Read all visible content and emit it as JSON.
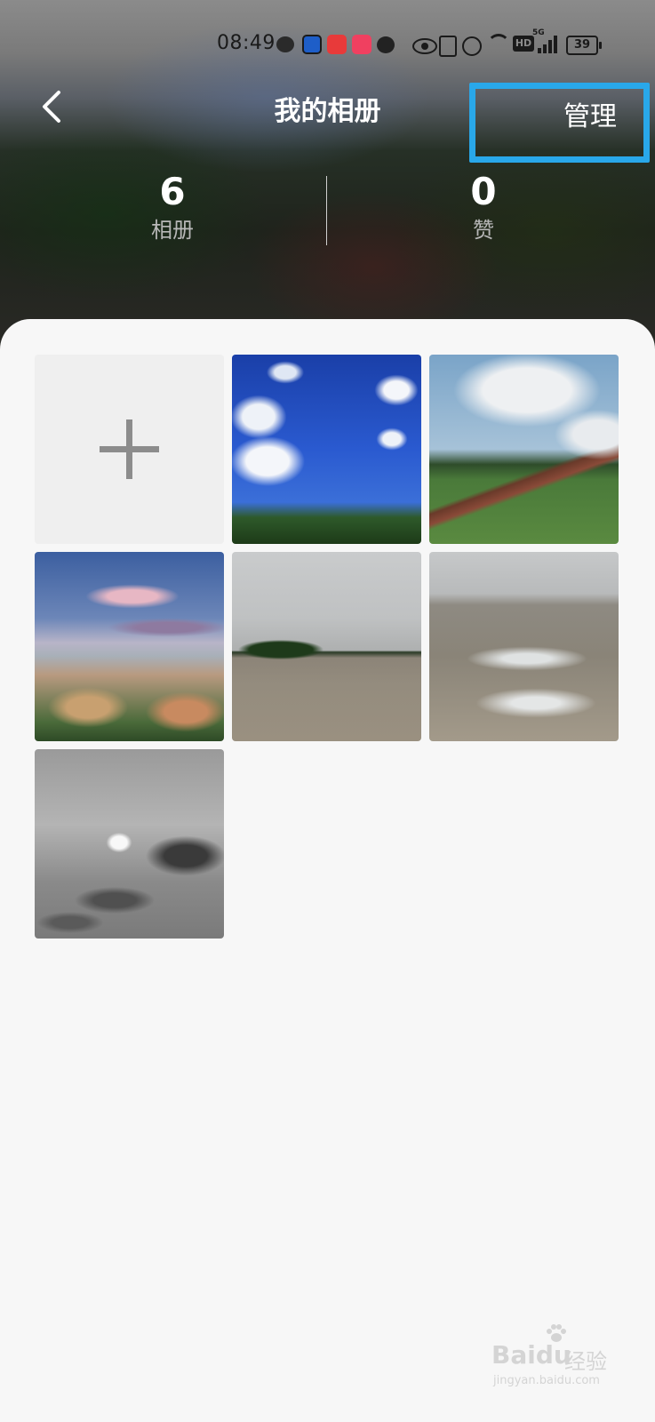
{
  "status_bar": {
    "time": "08:49",
    "battery": "39",
    "hd_label": "HD",
    "network_label": "5G",
    "notification_icons": [
      "wechat-icon",
      "qq-icon",
      "xiaohongshu-icon",
      "swan-app-icon",
      "message-icon"
    ],
    "system_icons": [
      "eye-icon",
      "nfc-icon",
      "alarm-icon",
      "wifi-icon",
      "hd-icon",
      "signal-icon",
      "battery-icon"
    ]
  },
  "header": {
    "title": "我的相册",
    "back_icon": "chevron-left-icon",
    "manage_label": "管理",
    "highlight_color": "#29a8ea"
  },
  "stats": {
    "albums": {
      "value": "6",
      "label": "相册"
    },
    "likes": {
      "value": "0",
      "label": "赞"
    }
  },
  "albums": {
    "add_tile_icon": "plus-icon",
    "photos": [
      {
        "name": "photo-blue-sky-clouds"
      },
      {
        "name": "photo-railway-landscape"
      },
      {
        "name": "photo-town-sunset"
      },
      {
        "name": "photo-sea-island"
      },
      {
        "name": "photo-beach-waves"
      },
      {
        "name": "photo-cloudy-sky-bw"
      }
    ]
  },
  "watermark": {
    "brand": "Bai",
    "brand_suffix": "du",
    "sub": "经验",
    "url": "jingyan.baidu.com"
  }
}
